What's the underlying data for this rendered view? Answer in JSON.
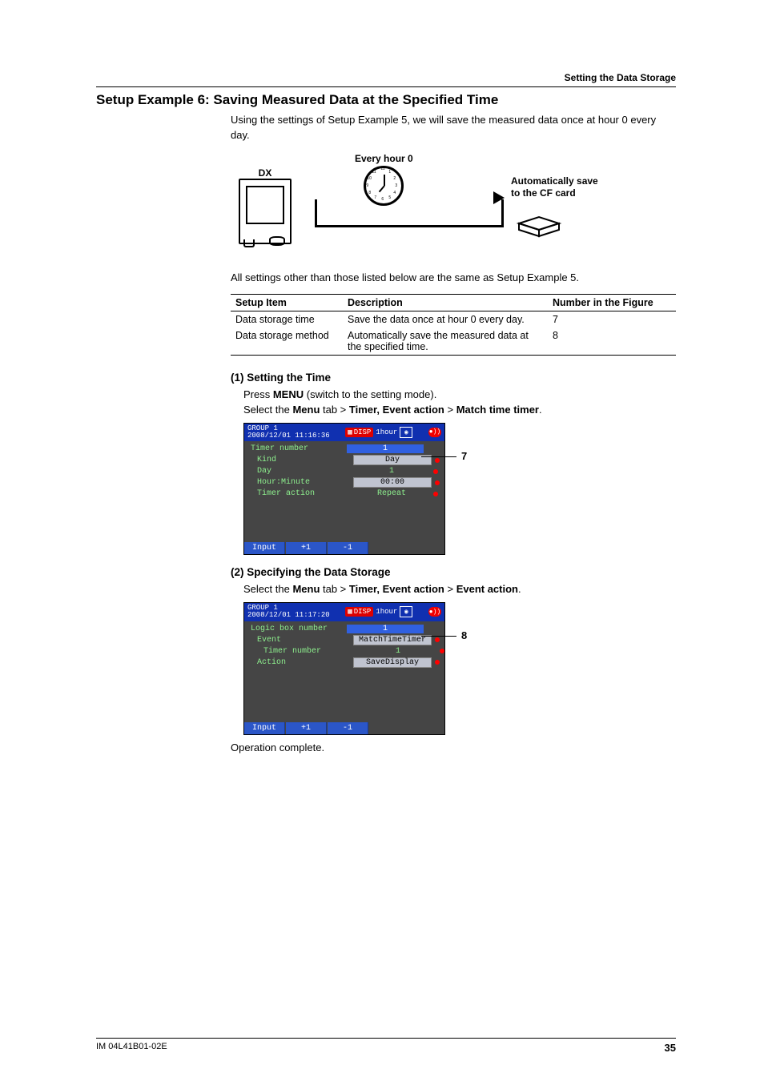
{
  "header": {
    "section_title": "Setting the Data Storage"
  },
  "title": "Setup Example 6: Saving Measured Data at the Specified Time",
  "intro": "Using the settings of Setup Example 5, we will save the measured data once at hour 0 every day.",
  "diagram": {
    "dx_label": "DX",
    "clock_label": "Every hour 0",
    "auto_save_l1": "Automatically save",
    "auto_save_l2": "to the CF card"
  },
  "settings_intro": "All settings other than those listed below are the same as Setup Example 5.",
  "table": {
    "headers": [
      "Setup Item",
      "Description",
      "Number in the Figure"
    ],
    "rows": [
      {
        "item": "Data storage time",
        "desc": "Save the data once at hour 0 every day.",
        "num": "7"
      },
      {
        "item": "Data storage method",
        "desc": "Automatically save the measured data at the specified time.",
        "num": "8"
      }
    ]
  },
  "step1": {
    "heading": "(1) Setting the Time",
    "line1_a": "Press ",
    "line1_b": "MENU",
    "line1_c": " (switch to the setting mode).",
    "line2_a": "Select the ",
    "line2_b": "Menu",
    "line2_c": " tab > ",
    "line2_d": "Timer, Event action",
    "line2_e": " > ",
    "line2_f": "Match time timer",
    "line2_g": ".",
    "callout": "7",
    "shot": {
      "group": "GROUP 1",
      "timestamp": "2008/12/01 11:16:36",
      "disp": "DISP",
      "mid": "1hour",
      "rows": [
        {
          "label": "Timer number",
          "value": "1",
          "sel": true,
          "dot": false,
          "sub": false
        },
        {
          "label": "Kind",
          "value": "Day",
          "box": true,
          "dot": true,
          "sub": true
        },
        {
          "label": "Day",
          "value": "1",
          "box": false,
          "dot": true,
          "sub": true
        },
        {
          "label": "Hour:Minute",
          "value": "00:00",
          "box": true,
          "dot": true,
          "sub": true
        },
        {
          "label": "Timer action",
          "value": "Repeat",
          "box": false,
          "dot": true,
          "sub": true
        }
      ],
      "footer": [
        "Input",
        "+1",
        "-1"
      ]
    }
  },
  "step2": {
    "heading": "(2) Specifying the Data Storage",
    "line1_a": "Select the ",
    "line1_b": "Menu",
    "line1_c": " tab > ",
    "line1_d": "Timer, Event action",
    "line1_e": " > ",
    "line1_f": "Event action",
    "line1_g": ".",
    "callout": "8",
    "shot": {
      "group": "GROUP 1",
      "timestamp": "2008/12/01 11:17:20",
      "disp": "DISP",
      "mid": "1hour",
      "rows": [
        {
          "label": "Logic box number",
          "value": "1",
          "sel": true,
          "dot": false,
          "sub": false
        },
        {
          "label": "Event",
          "value": "MatchTimeTimer",
          "box": true,
          "dot": true,
          "sub": true
        },
        {
          "label": "Timer number",
          "value": "1",
          "box": false,
          "dot": true,
          "sub": true
        },
        {
          "label": "Action",
          "value": "SaveDisplay",
          "box": true,
          "dot": true,
          "sub": true
        }
      ],
      "footer": [
        "Input",
        "+1",
        "-1"
      ]
    }
  },
  "complete": "Operation complete.",
  "footer": {
    "doc_id": "IM 04L41B01-02E",
    "page": "35"
  },
  "clock_numbers": [
    "12",
    "1",
    "2",
    "3",
    "4",
    "5",
    "6",
    "7",
    "8",
    "9",
    "10",
    "11"
  ]
}
